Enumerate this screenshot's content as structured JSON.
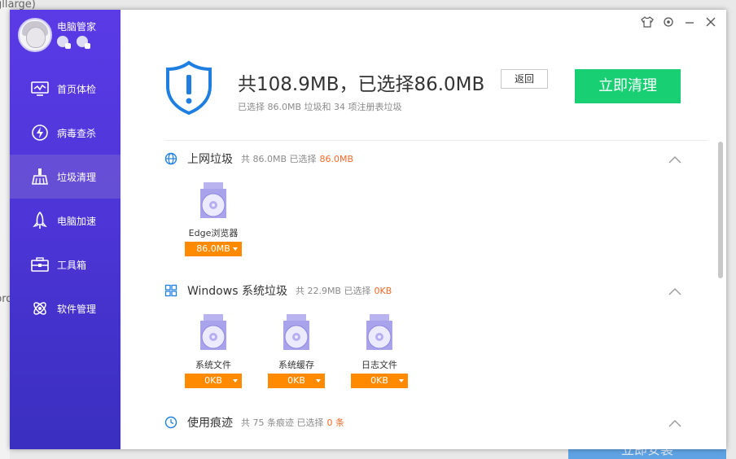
{
  "background": {
    "fragment_top": "gllarge)",
    "fragment_middle": "pro",
    "bottom_button": "立即安装"
  },
  "app": {
    "name": "电脑管家",
    "nav": [
      {
        "label": "首页体检",
        "icon": "monitor-icon"
      },
      {
        "label": "病毒查杀",
        "icon": "lightning-icon"
      },
      {
        "label": "垃圾清理",
        "icon": "broom-icon",
        "active": true
      },
      {
        "label": "电脑加速",
        "icon": "rocket-icon"
      },
      {
        "label": "工具箱",
        "icon": "toolbox-icon"
      },
      {
        "label": "软件管理",
        "icon": "software-icon"
      }
    ]
  },
  "header": {
    "headline": "共108.9MB，已选择86.0MB",
    "back_label": "返回",
    "subline": "已选择 86.0MB 垃圾和 34 项注册表垃圾",
    "clean_label": "立即清理"
  },
  "sections": [
    {
      "title": "上网垃圾",
      "meta": "共 86.0MB  已选择",
      "highlight": "86.0MB",
      "items": [
        {
          "label": "Edge浏览器",
          "size": "86.0MB"
        }
      ]
    },
    {
      "title": "Windows 系统垃圾",
      "meta": "共 22.9MB  已选择",
      "highlight": "0KB",
      "items": [
        {
          "label": "系统文件",
          "size": "0KB"
        },
        {
          "label": "系统缓存",
          "size": "0KB"
        },
        {
          "label": "日志文件",
          "size": "0KB"
        }
      ]
    },
    {
      "title": "使用痕迹",
      "meta": "共 75 条痕迹  已选择",
      "highlight": "0 条",
      "items": []
    }
  ],
  "colors": {
    "sidebar": "#4e35d8",
    "accent_green": "#18cf74",
    "accent_orange": "#ff8a00",
    "highlight": "#f26a2b",
    "shield": "#1f7fe0"
  }
}
